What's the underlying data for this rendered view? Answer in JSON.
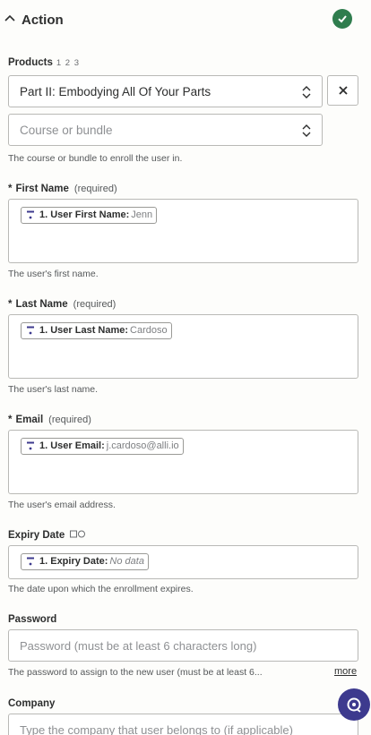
{
  "header": {
    "title": "Action",
    "status_icon": "check-circle-icon",
    "status_color": "#2f7d4e"
  },
  "products": {
    "label": "Products",
    "step_hint": "1 2 3",
    "selected": "Part II: Embodying All Of Your Parts",
    "clear_icon": "close-icon"
  },
  "course": {
    "placeholder": "Course or bundle",
    "help": "The course or bundle to enroll the user in."
  },
  "first_name": {
    "star": "*",
    "label": "First Name",
    "required": "(required)",
    "pill_key": "1. User First Name:",
    "pill_value": "Jenn",
    "help": "The user's first name."
  },
  "last_name": {
    "star": "*",
    "label": "Last Name",
    "required": "(required)",
    "pill_key": "1. User Last Name:",
    "pill_value": "Cardoso",
    "help": "The user's last name."
  },
  "email": {
    "star": "*",
    "label": "Email",
    "required": "(required)",
    "pill_key": "1. User Email:",
    "pill_value": "j.cardoso@alli.io",
    "help": "The user's email address."
  },
  "expiry": {
    "label": "Expiry Date",
    "pill_key": "1. Expiry Date:",
    "pill_value": "No data",
    "help": "The date upon which the enrollment expires."
  },
  "password": {
    "label": "Password",
    "placeholder": "Password (must be at least 6 characters long)",
    "help": "The password to assign to the new user (must be at least 6...",
    "more": "more"
  },
  "company": {
    "label": "Company",
    "placeholder": "Type the company that user belongs to (if applicable)"
  }
}
